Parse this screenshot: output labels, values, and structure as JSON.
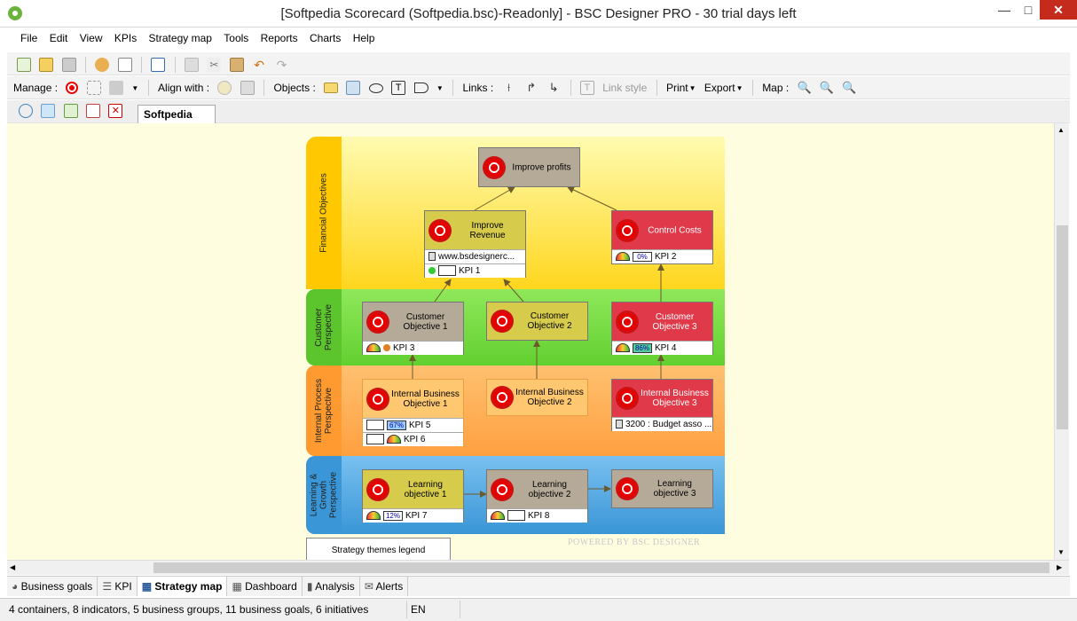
{
  "window": {
    "title": "[Softpedia Scorecard (Softpedia.bsc)-Readonly] - BSC Designer PRO - 30 trial days left"
  },
  "menu": [
    "File",
    "Edit",
    "View",
    "KPIs",
    "Strategy map",
    "Tools",
    "Reports",
    "Charts",
    "Help"
  ],
  "toolbar2": {
    "manage": "Manage :",
    "align": "Align with :",
    "objects": "Objects :",
    "links": "Links :",
    "link_style": "Link style",
    "print": "Print",
    "export": "Export",
    "map": "Map :"
  },
  "doc_tab": "Softpedia",
  "perspectives": [
    "Financial Objectives",
    "Customer Perspective",
    "Internal Process Perspective",
    "Learning & Growth Perspective"
  ],
  "nodes": {
    "improve_profits": "Improve profits",
    "improve_revenue": "Improve Revenue",
    "improve_revenue_link": "www.bsdesignerc...",
    "kpi1": "KPI 1",
    "control_costs": "Control Costs",
    "kpi2": "KPI 2",
    "kpi2_val": "0%",
    "cust1": "Customer Objective 1",
    "kpi3": "KPI 3",
    "cust2": "Customer Objective 2",
    "cust3": "Customer Objective 3",
    "kpi4": "KPI 4",
    "kpi4_val": "86%",
    "int1": "Internal Business Objective 1",
    "kpi5": "KPI 5",
    "kpi5_val": "67%",
    "kpi6": "KPI 6",
    "int2": "Internal Business Objective 2",
    "int3": "Internal Business Objective 3",
    "int3_init": "3200 : Budget asso ...",
    "learn1": "Learning objective 1",
    "kpi7": "KPI 7",
    "kpi7_val": "12%",
    "learn2": "Learning objective 2",
    "kpi8": "KPI 8",
    "learn3": "Learning objective 3"
  },
  "legend": "Strategy themes legend",
  "watermark": "POWERED BY BSC DESIGNER",
  "bottom_tabs": [
    "Business goals",
    "KPI",
    "Strategy map",
    "Dashboard",
    "Analysis",
    "Alerts"
  ],
  "status": {
    "text": "4 containers, 8 indicators, 5 business groups, 11 business goals, 6 initiatives",
    "lang": "EN"
  },
  "colors": {
    "financial": "#ffd61e",
    "customer": "#6ed63c",
    "internal": "#ffa84a",
    "learning": "#4aa6e6",
    "gray_node": "#b5aa98",
    "red_node": "#e03a4a",
    "yellow_node": "#d6cb4a"
  }
}
